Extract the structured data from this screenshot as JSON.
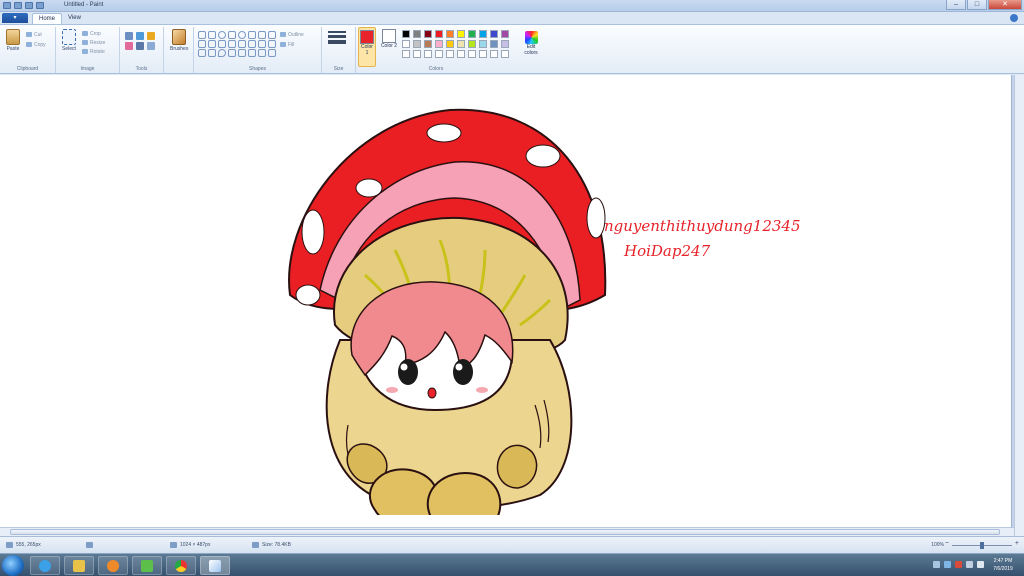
{
  "window": {
    "title": "Untitled - Paint",
    "controls": [
      "–",
      "□",
      "✕"
    ]
  },
  "ribbon": {
    "file_tab": "▾",
    "tabs": [
      "Home",
      "View"
    ],
    "active_tab": "Home",
    "groups": {
      "clipboard": {
        "label": "Clipboard",
        "paste": "Paste",
        "cut": "Cut",
        "copy": "Copy"
      },
      "image": {
        "label": "Image",
        "select": "Select",
        "crop": "Crop",
        "resize": "Resize",
        "rotate": "Rotate"
      },
      "tools": {
        "label": "Tools"
      },
      "brushes": {
        "label": "Brushes"
      },
      "shapes": {
        "label": "Shapes",
        "outline": "Outline",
        "fill": "Fill"
      },
      "size": {
        "label": "Size"
      },
      "colors": {
        "label": "Colors",
        "color1": "Color 1",
        "color2": "Color 2",
        "edit_colors": "Edit colors",
        "color1_value": "#e8232a",
        "color2_value": "#ffffff",
        "palette": [
          "#000000",
          "#7f7f7f",
          "#880015",
          "#ed1c24",
          "#ff7f27",
          "#fff200",
          "#22b14c",
          "#00a2e8",
          "#3f48cc",
          "#a349a4",
          "#ffffff",
          "#c3c3c3",
          "#b97a57",
          "#ffaec9",
          "#ffc90e",
          "#efe4b0",
          "#b5e61d",
          "#99d9ea",
          "#7092be",
          "#c8bfe7",
          "#ffffff",
          "#ffffff",
          "#ffffff",
          "#ffffff",
          "#ffffff",
          "#ffffff",
          "#ffffff",
          "#ffffff",
          "#ffffff",
          "#ffffff"
        ]
      }
    }
  },
  "canvas": {
    "signature_line1": "nguyenthithuydung12345",
    "signature_line2": "HoiDap247"
  },
  "status": {
    "cursor": "555, 265px",
    "selection": "",
    "image_size": "1024 × 487px",
    "file_size": "Size: 78.4KB",
    "zoom": "100%"
  },
  "taskbar": {
    "clock_time": "2:47 PM",
    "clock_date": "7/6/2019"
  }
}
